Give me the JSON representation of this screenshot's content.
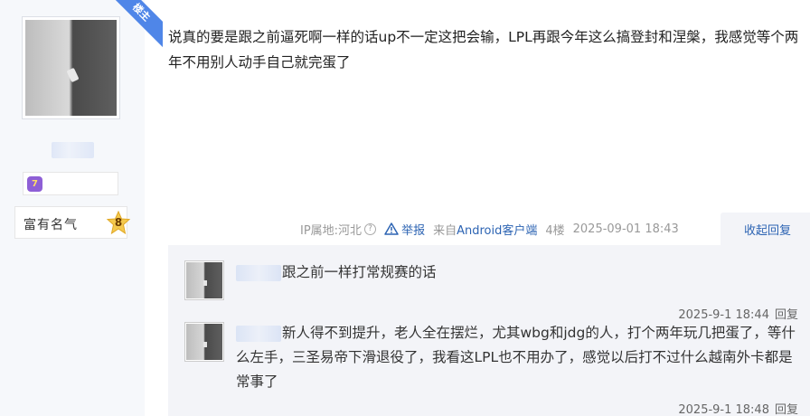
{
  "author": {
    "badge": "楼主",
    "level": "7",
    "fame_label": "富有名气",
    "fame_level": "8"
  },
  "post": {
    "content": "说真的要是跟之前逼死啊一样的话up不一定这把会输，LPL再跟今年这么搞登封和涅槃，我感觉等个两年不用别人动手自己就完蛋了",
    "ip": "IP属地:河北",
    "help_glyph": "?",
    "report_label": "举报",
    "from_prefix": "来自",
    "from_client": "Android客户端",
    "floor": "4楼",
    "time": "2025-09-01 18:43",
    "collapse_label": "收起回复"
  },
  "replies": [
    {
      "text": "跟之前一样打常规赛的话",
      "time": "2025-9-1 18:44",
      "reply_label": "回复"
    },
    {
      "text": "新人得不到提升，老人全在摆烂，尤其wbg和jdg的人，打个两年玩几把蛋了，等什么左手，三圣易帝下滑退役了，我看这LPL也不用办了，感觉以后打不过什么越南外卡都是常事了",
      "time": "2025-9-1 18:48",
      "reply_label": "回复"
    }
  ],
  "colors": {
    "link": "#2d64b3",
    "badge": "#4f86e8",
    "reply_bg": "#f3f4f8"
  }
}
